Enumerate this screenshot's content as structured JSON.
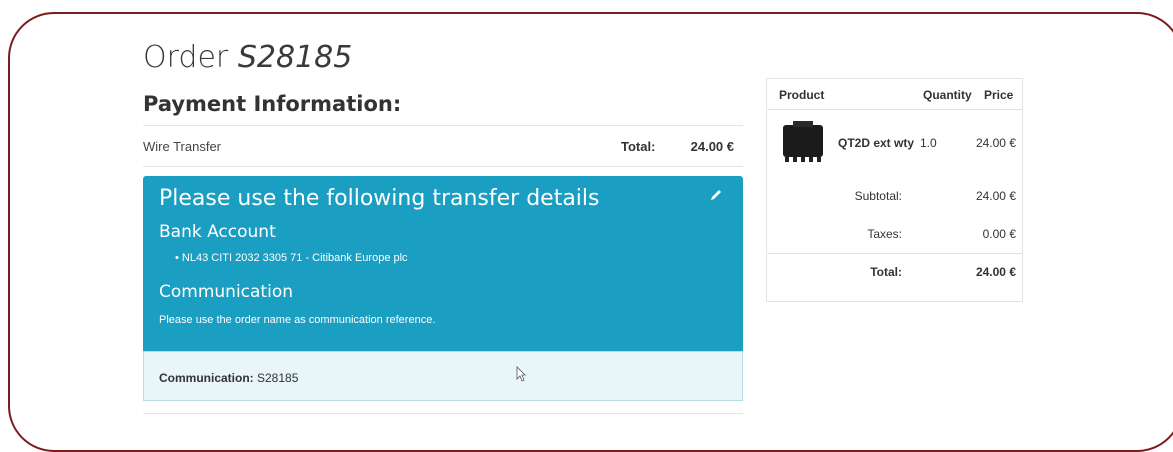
{
  "order": {
    "label": "Order",
    "number": "S28185"
  },
  "payment": {
    "heading": "Payment Information:",
    "method": "Wire Transfer",
    "total_label": "Total:",
    "total_value": "24.00 €"
  },
  "transfer": {
    "title": "Please use the following transfer details",
    "bank_heading": "Bank Account",
    "bank_line": "NL43 CITI 2032 3305 71 - Citibank Europe plc",
    "comm_heading": "Communication",
    "comm_note": "Please use the order name as communication reference.",
    "comm_label": "Communication:",
    "comm_value": "S28185"
  },
  "summary": {
    "headers": {
      "product": "Product",
      "quantity": "Quantity",
      "price": "Price"
    },
    "line": {
      "name": "QT2D ext wty",
      "qty": "1.0",
      "price": "24.00 €"
    },
    "subtotal_label": "Subtotal:",
    "subtotal_value": "24.00 €",
    "taxes_label": "Taxes:",
    "taxes_value": "0.00 €",
    "total_label": "Total:",
    "total_value": "24.00 €"
  },
  "colors": {
    "accent": "#1a9ec1",
    "frame": "#7a1c1c",
    "comm_bg": "#e8f5f9"
  },
  "icons": {
    "edit": "pencil-icon",
    "cursor": "mouse-pointer-icon",
    "product": "product-thumbnail"
  }
}
